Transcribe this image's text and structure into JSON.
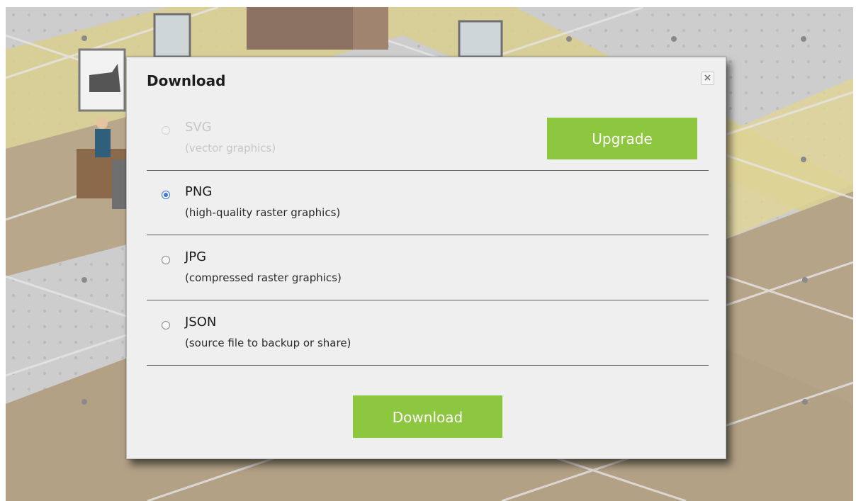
{
  "dialog": {
    "title": "Download",
    "close_label": "×",
    "upgrade_label": "Upgrade",
    "download_label": "Download"
  },
  "options": [
    {
      "format": "SVG",
      "description": "(vector graphics)",
      "state": "disabled"
    },
    {
      "format": "PNG",
      "description": "(high-quality raster graphics)",
      "state": "selected"
    },
    {
      "format": "JPG",
      "description": "(compressed raster graphics)",
      "state": "unselected"
    },
    {
      "format": "JSON",
      "description": "(source file to backup or share)",
      "state": "unselected"
    }
  ],
  "colors": {
    "accent_green": "#8dc63f",
    "radio_selected": "#3a78e0",
    "dialog_bg": "#efefef"
  }
}
